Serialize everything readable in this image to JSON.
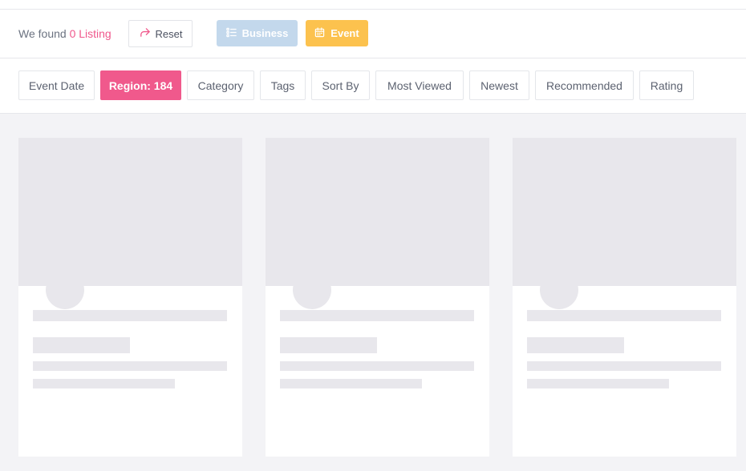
{
  "results": {
    "found_prefix": "We found",
    "found_count": "0 Listing",
    "reset_label": "Reset"
  },
  "types": {
    "business_label": "Business",
    "event_label": "Event"
  },
  "filters": [
    {
      "label": "Event Date",
      "active": false
    },
    {
      "label": "Region: 184",
      "active": true
    },
    {
      "label": "Category",
      "active": false
    },
    {
      "label": "Tags",
      "active": false
    },
    {
      "label": "Sort By",
      "active": false
    },
    {
      "label": "Most Viewed",
      "active": false
    },
    {
      "label": "Newest",
      "active": false
    },
    {
      "label": "Recommended",
      "active": false
    },
    {
      "label": "Rating",
      "active": false
    }
  ],
  "colors": {
    "accent_pink": "#f0598c",
    "business_blue": "#c3d8ec",
    "event_yellow": "#fcc24e",
    "skeleton": "#e8e7ec"
  },
  "icons": {
    "reset": "share-arrow-icon",
    "business": "list-icon",
    "event": "calendar-icon"
  }
}
